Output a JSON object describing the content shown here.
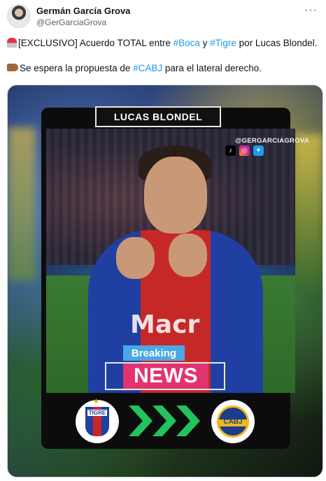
{
  "tweet": {
    "author_name": "Germán García Grova",
    "author_handle": "@GerGarciaGrova",
    "more_label": "···",
    "line1": {
      "prefix": "[EXCLUSIVO] Acuerdo TOTAL entre ",
      "tag1": "#Boca",
      "mid": " y ",
      "tag2": "#Tigre",
      "suffix": " por Lucas Blondel."
    },
    "line2": {
      "prefix": "Se espera la propuesta de ",
      "tag": "#CABJ",
      "suffix": " para el lateral derecho."
    }
  },
  "media": {
    "title": "LUCAS BLONDEL",
    "watermark_handle": "@GERGARCIAGROVA",
    "social_icons": [
      "tiktok-icon",
      "instagram-icon",
      "twitter-icon"
    ],
    "sponsor_text": "Macr",
    "breaking_label": "Breaking",
    "news_label": "NEWS",
    "left_crest_text": "TIGRE",
    "right_crest_text": "CABJ"
  },
  "colors": {
    "link": "#1d9bf0",
    "breaking_bg": "#4aa8e6",
    "news_bg": "#e0336f",
    "arrow_green": "#22c35e",
    "boca_blue": "#1a3e8c",
    "boca_gold": "#f1b81a"
  }
}
